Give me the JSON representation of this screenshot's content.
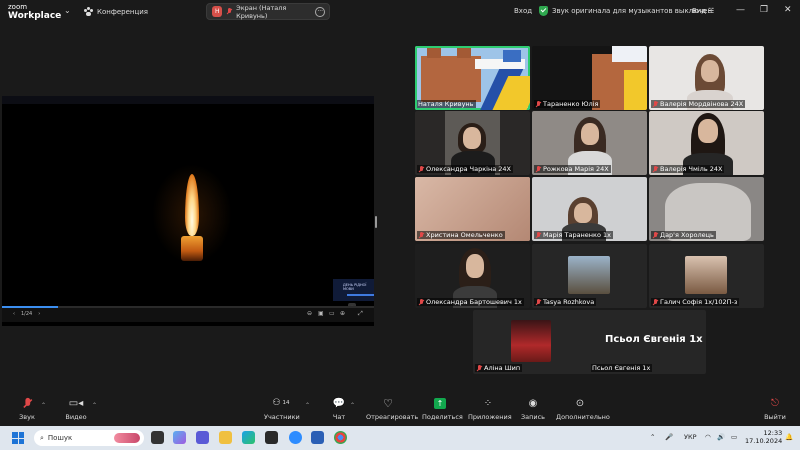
{
  "titlebar": {
    "brand_line1": "zoom",
    "brand_line2": "Workplace",
    "meeting_label": "Конференция",
    "share_avatar": "Н",
    "share_label": "Экран (Наталя Кривунь)",
    "more_glyph": "···",
    "signin": "Вход",
    "audio_notice": "Звук оригинала для музыкантов выключен",
    "view_label": "Вид",
    "view_grid_glyph": "☷"
  },
  "shared_screen": {
    "mini_thumb_text": "ДЕНЬ РІДНОЇ МОВИ",
    "page_indicator": "1/24",
    "progress": 0.15
  },
  "participants": [
    {
      "name": "Наталя Кривунь",
      "active": true
    },
    {
      "name": "Тараненко Юлія",
      "active": false
    },
    {
      "name": "Валерія Мордвінова 24Х",
      "active": false
    },
    {
      "name": "Олександра Чаркіна 24Х",
      "active": false
    },
    {
      "name": "Рожкова Марія 24Х",
      "active": false
    },
    {
      "name": "Валерія Чміль 24Х",
      "active": false
    },
    {
      "name": "Христина Омельченко",
      "active": false
    },
    {
      "name": "Марія Тараненко 1х",
      "active": false
    },
    {
      "name": "Дар'я Хоролець",
      "active": false
    },
    {
      "name": "Олександра Бартошевич 1х",
      "active": false
    },
    {
      "name": "Tasya Rozhkova",
      "active": false
    },
    {
      "name": "Галич Софія 1х/102П-з",
      "active": false
    },
    {
      "name": "Аліна Шип",
      "active": false
    },
    {
      "name": "Псьол Євгенія 1х",
      "active": false
    }
  ],
  "featured_name": "Псьол Євгенія 1х",
  "toolbar": {
    "audio": "Звук",
    "video": "Видео",
    "participants": "Участники",
    "participants_count": "14",
    "chat": "Чат",
    "react": "Отреагировать",
    "share": "Поделиться",
    "apps": "Приложения",
    "record": "Запись",
    "more": "Дополнительно",
    "leave": "Выйти"
  },
  "taskbar": {
    "search_placeholder": "Пошук",
    "language": "УКР",
    "time": "12:33",
    "date": "17.10.2024"
  },
  "colors": {
    "active_speaker": "#2ecc71",
    "mic_muted": "#e04848",
    "share_green": "#12a84e",
    "progress": "#3b8ef0"
  }
}
